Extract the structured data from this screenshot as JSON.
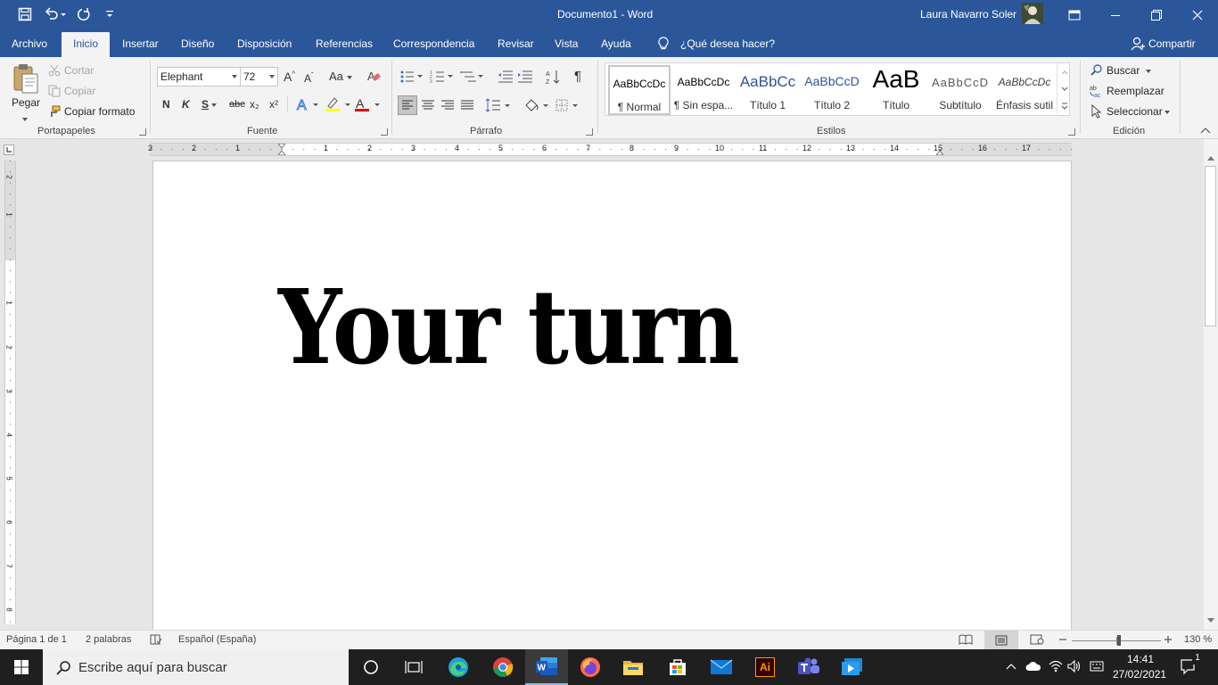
{
  "titlebar": {
    "doc_title": "Documento1  -  Word",
    "user": "Laura Navarro Soler"
  },
  "tabs": [
    "Archivo",
    "Inicio",
    "Insertar",
    "Diseño",
    "Disposición",
    "Referencias",
    "Correspondencia",
    "Revisar",
    "Vista",
    "Ayuda"
  ],
  "active_tab": "Inicio",
  "tell_me": "¿Qué desea hacer?",
  "share": "Compartir",
  "clipboard": {
    "paste": "Pegar",
    "cut": "Cortar",
    "copy": "Copiar",
    "format_painter": "Copiar formato",
    "group": "Portapapeles"
  },
  "font": {
    "name": "Elephant",
    "size": "72",
    "bold": "N",
    "italic": "K",
    "underline": "S",
    "strike": "abc",
    "subscript": "x₂",
    "superscript": "x²",
    "change_case": "Aa",
    "group": "Fuente"
  },
  "paragraph": {
    "pilcrow": "¶",
    "group": "Párrafo"
  },
  "styles": {
    "items": [
      {
        "preview": "AaBbCcDc",
        "name": "¶ Normal"
      },
      {
        "preview": "AaBbCcDc",
        "name": "¶ Sin espa..."
      },
      {
        "preview": "AaBbCc",
        "name": "Título 1"
      },
      {
        "preview": "AaBbCcD",
        "name": "Título 2"
      },
      {
        "preview": "AaB",
        "name": "Título"
      },
      {
        "preview": "AaBbCcD",
        "name": "Subtítulo"
      },
      {
        "preview": "AaBbCcDc",
        "name": "Énfasis sutil"
      }
    ],
    "group": "Estilos"
  },
  "editing": {
    "find": "Buscar",
    "replace": "Reemplazar",
    "select": "Seleccionar",
    "group": "Edición"
  },
  "ruler": {
    "h_labels": [
      "3",
      "2",
      "1",
      "1",
      "2",
      "3",
      "4",
      "5",
      "6",
      "7",
      "8",
      "9",
      "10",
      "11",
      "12",
      "13",
      "14",
      "15",
      "16",
      "17"
    ],
    "v_labels": [
      "2",
      "1",
      "1",
      "2",
      "3",
      "4",
      "5",
      "6",
      "7",
      "8"
    ]
  },
  "document": {
    "text": "Your turn"
  },
  "statusbar": {
    "page": "Página 1 de 1",
    "words": "2 palabras",
    "language": "Español (España)",
    "zoom": "130 %"
  },
  "taskbar": {
    "search_placeholder": "Escribe aquí para buscar",
    "time": "14:41",
    "date": "27/02/2021",
    "notifications": "1",
    "ai_label": "Ai"
  },
  "colors": {
    "word_blue": "#2b579a",
    "ribbon_bg": "#f3f3f3",
    "taskbar_bg": "#1f1f1f"
  }
}
